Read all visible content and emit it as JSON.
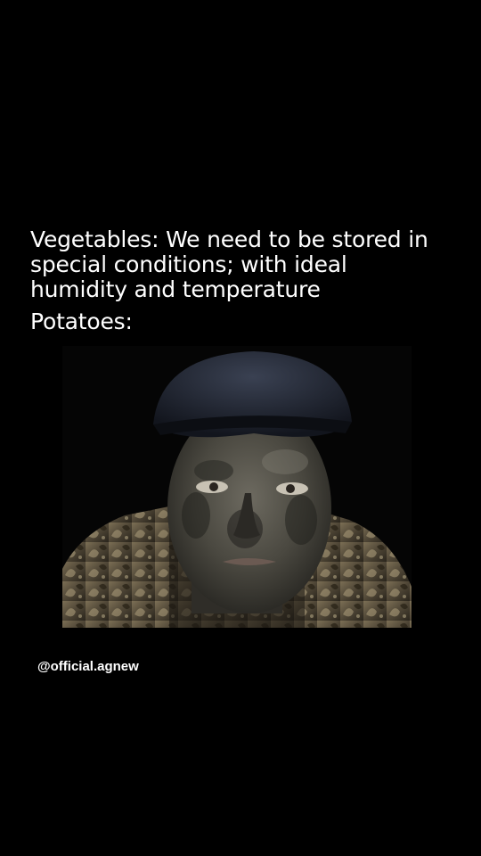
{
  "meme": {
    "caption_lines": [
      "Vegetables: We need to be stored in",
      "special conditions; with ideal",
      "humidity and temperature"
    ],
    "punchline": "Potatoes:",
    "watermark": "@official.agnew"
  },
  "colors": {
    "background": "#000000",
    "text": "#ffffff"
  }
}
